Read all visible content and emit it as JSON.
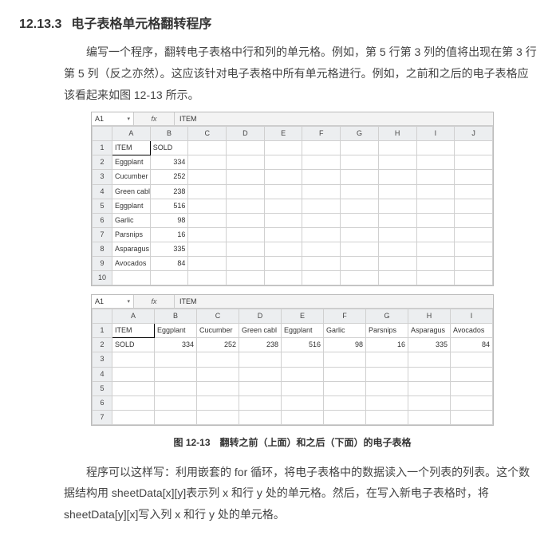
{
  "section_number": "12.13.3",
  "section_title": "电子表格单元格翻转程序",
  "paragraph1": "编写一个程序，翻转电子表格中行和列的单元格。例如，第 5 行第 3 列的值将出现在第 3 行第 5 列（反之亦然）。这应该针对电子表格中所有单元格进行。例如，之前和之后的电子表格应该看起来如图 12-13 所示。",
  "figure_caption": "图 12-13　翻转之前（上面）和之后（下面）的电子表格",
  "paragraph2": "程序可以这样写：利用嵌套的 for 循环，将电子表格中的数据读入一个列表的列表。这个数据结构用 sheetData[x][y]表示列 x 和行 y 处的单元格。然后，在写入新电子表格时，将 sheetData[y][x]写入列 x 和行 y 处的单元格。",
  "sheet_common": {
    "name_box": "A1",
    "formula_value": "ITEM",
    "fx_label": "fx"
  },
  "sheet_before": {
    "columns": [
      "A",
      "B",
      "C",
      "D",
      "E",
      "F",
      "G",
      "H",
      "I",
      "J"
    ],
    "rows": [
      [
        "ITEM",
        "SOLD",
        "",
        "",
        "",
        "",
        "",
        "",
        "",
        ""
      ],
      [
        "Eggplant",
        "334",
        "",
        "",
        "",
        "",
        "",
        "",
        "",
        ""
      ],
      [
        "Cucumber",
        "252",
        "",
        "",
        "",
        "",
        "",
        "",
        "",
        ""
      ],
      [
        "Green cabl",
        "238",
        "",
        "",
        "",
        "",
        "",
        "",
        "",
        ""
      ],
      [
        "Eggplant",
        "516",
        "",
        "",
        "",
        "",
        "",
        "",
        "",
        ""
      ],
      [
        "Garlic",
        "98",
        "",
        "",
        "",
        "",
        "",
        "",
        "",
        ""
      ],
      [
        "Parsnips",
        "16",
        "",
        "",
        "",
        "",
        "",
        "",
        "",
        ""
      ],
      [
        "Asparagus",
        "335",
        "",
        "",
        "",
        "",
        "",
        "",
        "",
        ""
      ],
      [
        "Avocados",
        "84",
        "",
        "",
        "",
        "",
        "",
        "",
        "",
        ""
      ],
      [
        "",
        "",
        "",
        "",
        "",
        "",
        "",
        "",
        "",
        ""
      ]
    ]
  },
  "sheet_after": {
    "columns": [
      "A",
      "B",
      "C",
      "D",
      "E",
      "F",
      "G",
      "H",
      "I"
    ],
    "rows": [
      [
        "ITEM",
        "Eggplant",
        "Cucumber",
        "Green cabl",
        "Eggplant",
        "Garlic",
        "Parsnips",
        "Asparagus",
        "Avocados"
      ],
      [
        "SOLD",
        "334",
        "252",
        "238",
        "516",
        "98",
        "16",
        "335",
        "84"
      ],
      [
        "",
        "",
        "",
        "",
        "",
        "",
        "",
        "",
        ""
      ],
      [
        "",
        "",
        "",
        "",
        "",
        "",
        "",
        "",
        ""
      ],
      [
        "",
        "",
        "",
        "",
        "",
        "",
        "",
        "",
        ""
      ],
      [
        "",
        "",
        "",
        "",
        "",
        "",
        "",
        "",
        ""
      ],
      [
        "",
        "",
        "",
        "",
        "",
        "",
        "",
        "",
        ""
      ]
    ]
  },
  "chart_data": {
    "type": "table",
    "title": "Spreadsheet cell inversion example",
    "before": {
      "headers": [
        "ITEM",
        "SOLD"
      ],
      "records": [
        {
          "ITEM": "Eggplant",
          "SOLD": 334
        },
        {
          "ITEM": "Cucumber",
          "SOLD": 252
        },
        {
          "ITEM": "Green cabl",
          "SOLD": 238
        },
        {
          "ITEM": "Eggplant",
          "SOLD": 516
        },
        {
          "ITEM": "Garlic",
          "SOLD": 98
        },
        {
          "ITEM": "Parsnips",
          "SOLD": 16
        },
        {
          "ITEM": "Asparagus",
          "SOLD": 335
        },
        {
          "ITEM": "Avocados",
          "SOLD": 84
        }
      ]
    },
    "after": {
      "row_headers": [
        "ITEM",
        "SOLD"
      ],
      "columns": [
        "Eggplant",
        "Cucumber",
        "Green cabl",
        "Eggplant",
        "Garlic",
        "Parsnips",
        "Asparagus",
        "Avocados"
      ],
      "values": [
        334,
        252,
        238,
        516,
        98,
        16,
        335,
        84
      ]
    }
  }
}
